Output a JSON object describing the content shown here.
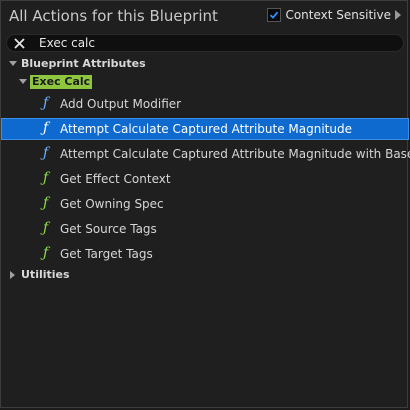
{
  "header": {
    "title": "All Actions for this Blueprint",
    "context_sensitive_label": "Context Sensitive",
    "context_sensitive_checked": true
  },
  "search": {
    "value": "Exec calc"
  },
  "tree": {
    "category": "Blueprint Attributes",
    "subcategory": "Exec Calc",
    "items": [
      {
        "label": "Add Output Modifier",
        "icon": "function-icon",
        "icon_color": "#6fb3ff"
      },
      {
        "label": "Attempt Calculate Captured Attribute Magnitude",
        "icon": "function-icon",
        "icon_color": "#ffffff"
      },
      {
        "label": "Attempt Calculate Captured Attribute Magnitude with Base",
        "icon": "function-icon",
        "icon_color": "#6fb3ff"
      },
      {
        "label": "Get Effect Context",
        "icon": "function-icon",
        "icon_color": "#8ee04a"
      },
      {
        "label": "Get Owning Spec",
        "icon": "function-icon",
        "icon_color": "#8ee04a"
      },
      {
        "label": "Get Source Tags",
        "icon": "function-icon",
        "icon_color": "#8ee04a"
      },
      {
        "label": "Get Target Tags",
        "icon": "function-icon",
        "icon_color": "#8ee04a"
      }
    ],
    "other_category": "Utilities"
  },
  "colors": {
    "selection": "#0f6ad0",
    "subcategory_highlight": "#8ec63f",
    "checkbox_check": "#2f8fff"
  }
}
